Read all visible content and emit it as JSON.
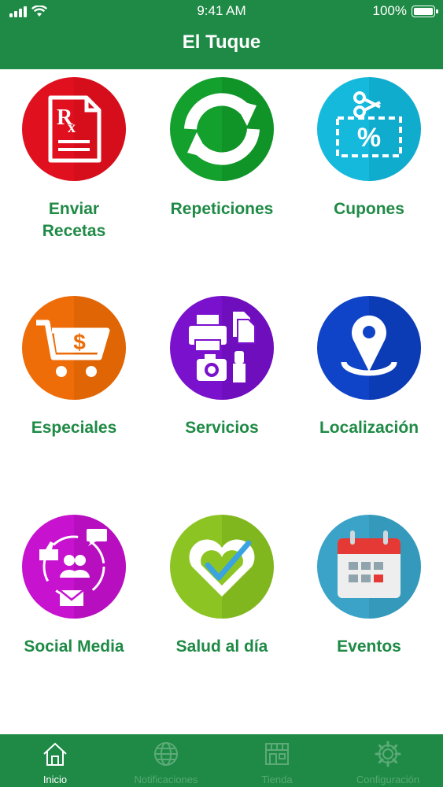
{
  "status_bar": {
    "time": "9:41 AM",
    "battery": "100%"
  },
  "header": {
    "title": "El Tuque"
  },
  "tiles": [
    {
      "label": "Enviar Recetas",
      "icon": "prescription-icon",
      "color": "#e0101e"
    },
    {
      "label": "Repeticiones",
      "icon": "refresh-arrows-icon",
      "color": "#13a02c"
    },
    {
      "label": "Cupones",
      "icon": "coupon-scissors-icon",
      "color": "#14b9dc"
    },
    {
      "label": "Especiales",
      "icon": "shopping-cart-dollar-icon",
      "color": "#ee6d08"
    },
    {
      "label": "Servicios",
      "icon": "services-icon",
      "color": "#7a11cc"
    },
    {
      "label": "Localización",
      "icon": "location-pin-icon",
      "color": "#0f43c8"
    },
    {
      "label": "Social Media",
      "icon": "social-media-icon",
      "color": "#c712cf"
    },
    {
      "label": "Salud al día",
      "icon": "heart-check-icon",
      "color": "#8cc523"
    },
    {
      "label": "Eventos",
      "icon": "calendar-icon",
      "color": "#3aa3c7"
    }
  ],
  "tabbar": {
    "tabs": [
      {
        "label": "Inicio",
        "icon": "home-icon",
        "active": true
      },
      {
        "label": "Notificaciones",
        "icon": "globe-icon",
        "active": false
      },
      {
        "label": "Tienda",
        "icon": "store-icon",
        "active": false
      },
      {
        "label": "Configuración",
        "icon": "gear-icon",
        "active": false
      }
    ]
  },
  "colors": {
    "brand_green": "#1e8a45",
    "label_green": "#1e8a45",
    "background": "#ffffff"
  }
}
